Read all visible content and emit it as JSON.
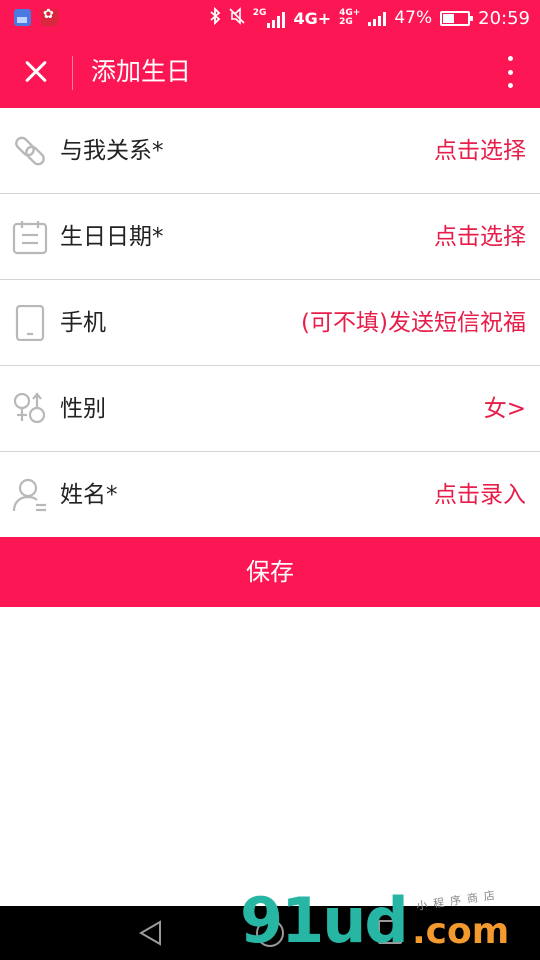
{
  "status_bar": {
    "net_small": "2G",
    "net_4g_a": "4G+",
    "net_4g_b": "4G+",
    "net_2g_b": "2G",
    "battery_text": "47%",
    "battery_level": 0.47,
    "time": "20:59",
    "icons": [
      "gallery-app-icon",
      "huawei-app-icon",
      "bluetooth-icon",
      "mute-icon",
      "signal-icon",
      "battery-icon"
    ]
  },
  "app_bar": {
    "title": "添加生日",
    "close_icon": "close-icon",
    "more_icon": "more-vertical-icon"
  },
  "form": {
    "rows": [
      {
        "icon": "link-icon",
        "label": "与我关系*",
        "value": "点击选择"
      },
      {
        "icon": "calendar-icon",
        "label": "生日日期*",
        "value": "点击选择"
      },
      {
        "icon": "phone-icon",
        "label": "手机",
        "value": "(可不填)发送短信祝福"
      },
      {
        "icon": "gender-icon",
        "label": "性别",
        "value": "女>"
      },
      {
        "icon": "person-icon",
        "label": "姓名*",
        "value": "点击录入"
      }
    ]
  },
  "save_button": {
    "label": "保存"
  },
  "nav_bar": {
    "icons": [
      "back-icon",
      "home-icon",
      "recent-apps-icon"
    ]
  },
  "watermark": {
    "main": "91ud",
    "suffix": ".com",
    "tagline": "小程序商店"
  },
  "colors": {
    "brand": "#fc1654",
    "value_text": "#e81e4a",
    "divider": "#d4d4d4"
  }
}
